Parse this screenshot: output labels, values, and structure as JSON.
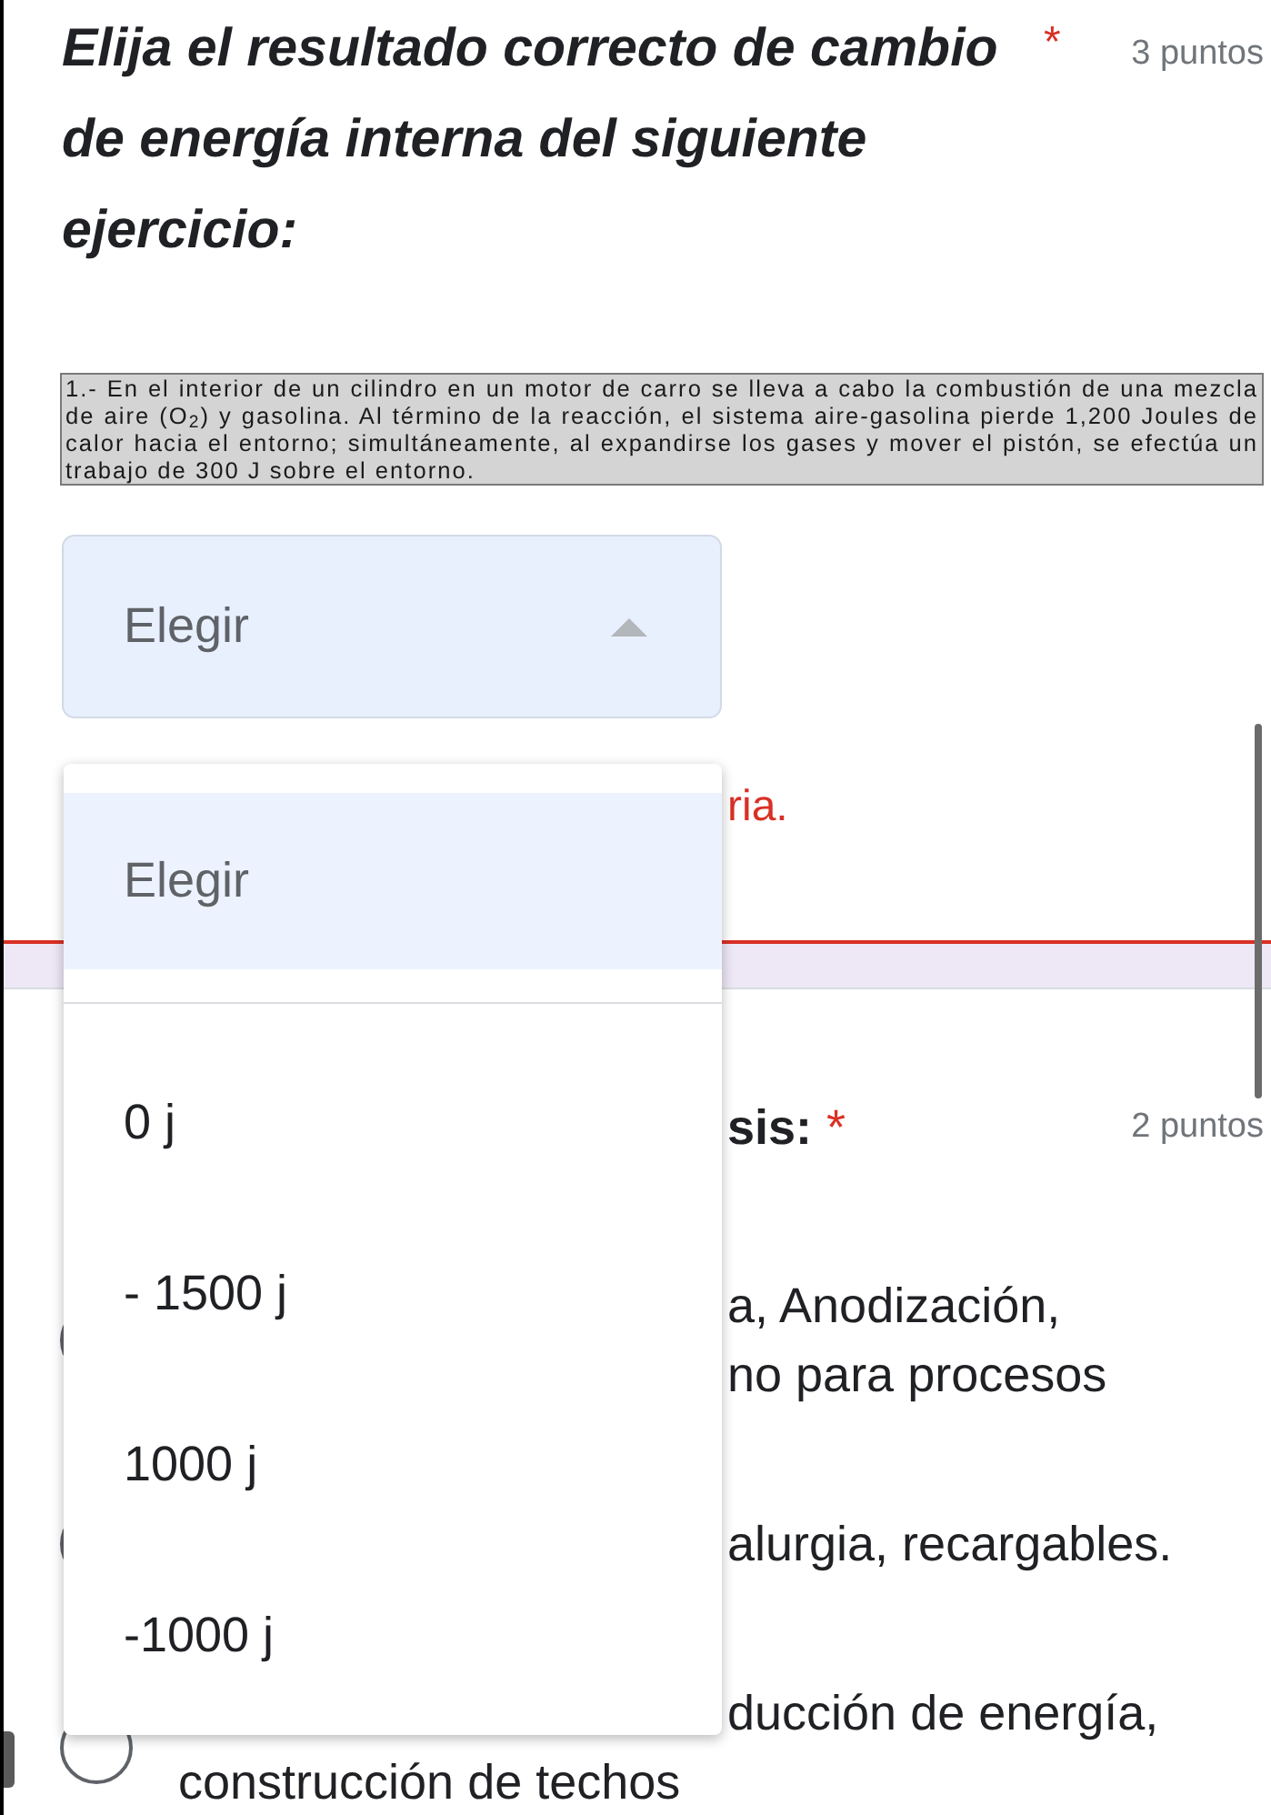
{
  "question": {
    "title": "Elija el resultado correcto de cambio de energía interna del siguiente ejercicio:",
    "required_mark": "*",
    "points": "3 puntos",
    "statement": "1.- En el interior de un cilindro en un motor de carro se lleva a cabo la combustión de una mezcla de aire (O$_{2}$) y gasolina. Al término de la reacción, el sistema aire-gasolina pierde 1,200 Joules de calor hacia el entorno; simultáneamente, al expandirse los gases y mover el pistón, se efectúa un trabajo de 300 J sobre el entorno.",
    "dropdown": {
      "value": "Elegir",
      "expanded": true
    },
    "error": "ria."
  },
  "dropdown_menu": {
    "items": [
      {
        "label": "Elegir",
        "kind": "placeholder",
        "selected": true
      },
      {
        "label": "0 j",
        "kind": "option",
        "selected": false
      },
      {
        "label": "- 1500 j",
        "kind": "option",
        "selected": false
      },
      {
        "label": "1000 j",
        "kind": "option",
        "selected": false
      },
      {
        "label": "-1000 j",
        "kind": "option",
        "selected": false
      }
    ]
  },
  "next_question": {
    "title": "sis:",
    "required_mark": "*",
    "points": "2 puntos",
    "options": [
      {
        "selected": false,
        "lines": [
          "a, Anodización,",
          "no para procesos"
        ]
      },
      {
        "selected": false,
        "lines": [
          "alurgia, recargables."
        ]
      },
      {
        "selected": false,
        "lines": [
          "ducción de energía,",
          "construcción de techos"
        ]
      }
    ]
  }
}
